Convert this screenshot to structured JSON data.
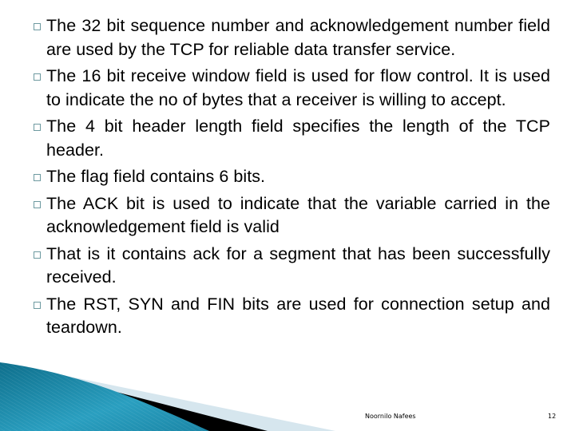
{
  "slide": {
    "bullets": [
      {
        "text": "The 32 bit sequence number and acknowledgement number field are used by the TCP for reliable data transfer service."
      },
      {
        "text": "The 16 bit receive window field is used for flow control. It is used to indicate the no of bytes that a receiver is willing to accept."
      },
      {
        "text": "The 4 bit header length field specifies the length of the TCP header."
      },
      {
        "text": "The flag field contains 6 bits."
      },
      {
        "text": "The ACK bit is used to indicate that the variable carried in the acknowledgement field is valid"
      },
      {
        "text": "That is it contains ack for a segment that has been successfully received."
      },
      {
        "text": "The RST, SYN and FIN bits are used for connection setup and teardown."
      }
    ],
    "bullet_icon": "hollow-square-bullet",
    "footer": {
      "author": "Noornilo Nafees",
      "page_number": "12"
    },
    "colors": {
      "accent_blue": "#1a8aa8",
      "bullet_outline": "#6e9aa0",
      "band_light": "#d6e6ee"
    }
  }
}
